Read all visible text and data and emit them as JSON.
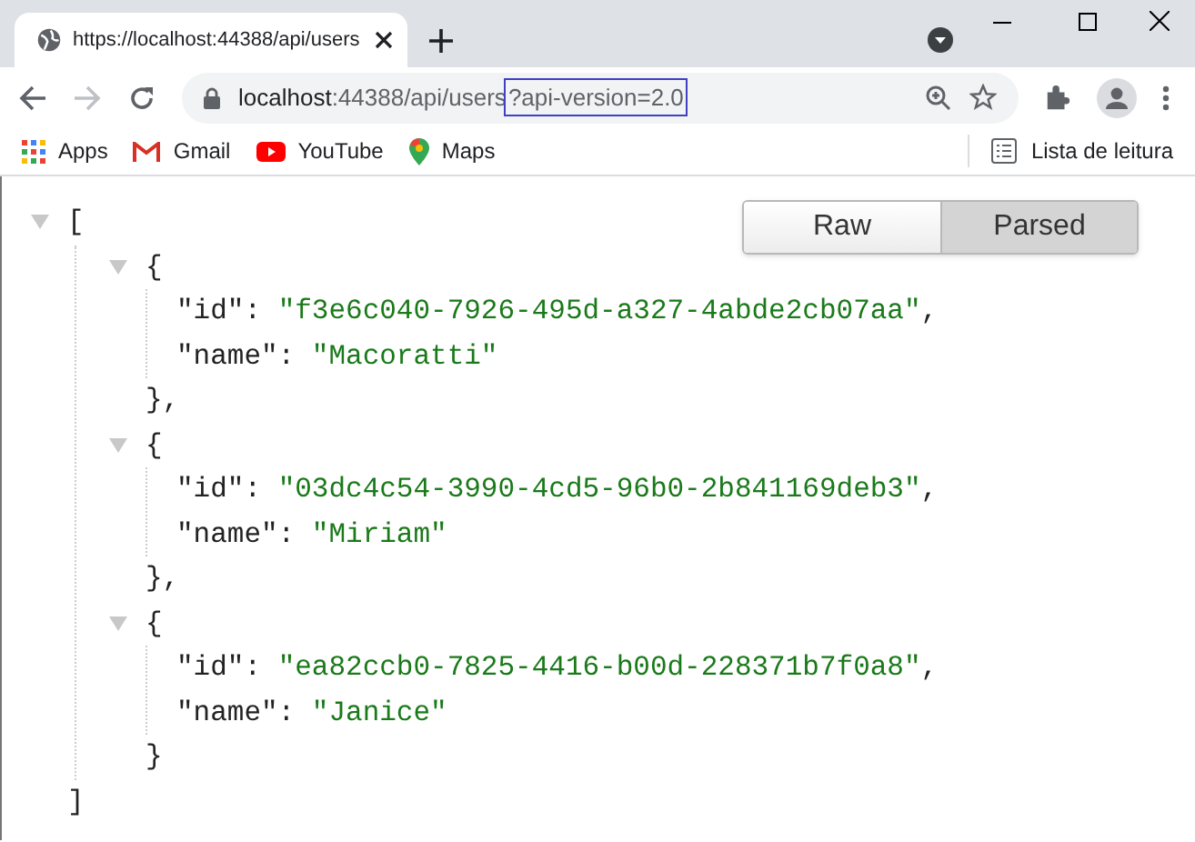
{
  "tab": {
    "title": "https://localhost:44388/api/users"
  },
  "address": {
    "host": "localhost",
    "path": ":44388/api/users",
    "query": "?api-version=2.0"
  },
  "bookmarks": [
    {
      "label": "Apps",
      "kind": "apps"
    },
    {
      "label": "Gmail",
      "kind": "gmail"
    },
    {
      "label": "YouTube",
      "kind": "youtube"
    },
    {
      "label": "Maps",
      "kind": "maps"
    }
  ],
  "reading_list": "Lista de leitura",
  "view_toggle": [
    {
      "label": "Raw",
      "selected": false
    },
    {
      "label": "Parsed",
      "selected": true
    }
  ],
  "json": {
    "open": "[",
    "close": "]",
    "expanded": true,
    "items": [
      {
        "open": "{",
        "close": "},",
        "expanded": true,
        "fields": [
          {
            "key": "\"id\"",
            "sep": ":",
            "value": "\"f3e6c040-7926-495d-a327-4abde2cb07aa\"",
            "comma": ","
          },
          {
            "key": "\"name\"",
            "sep": ":",
            "value": "\"Macoratti\""
          }
        ]
      },
      {
        "open": "{",
        "close": "},",
        "expanded": true,
        "fields": [
          {
            "key": "\"id\"",
            "sep": ":",
            "value": "\"03dc4c54-3990-4cd5-96b0-2b841169deb3\"",
            "comma": ","
          },
          {
            "key": "\"name\"",
            "sep": ":",
            "value": "\"Miriam\""
          }
        ]
      },
      {
        "open": "{",
        "close": "}",
        "expanded": true,
        "fields": [
          {
            "key": "\"id\"",
            "sep": ":",
            "value": "\"ea82ccb0-7825-4416-b00d-228371b7f0a8\"",
            "comma": ","
          },
          {
            "key": "\"name\"",
            "sep": ":",
            "value": "\"Janice\""
          }
        ]
      }
    ]
  }
}
